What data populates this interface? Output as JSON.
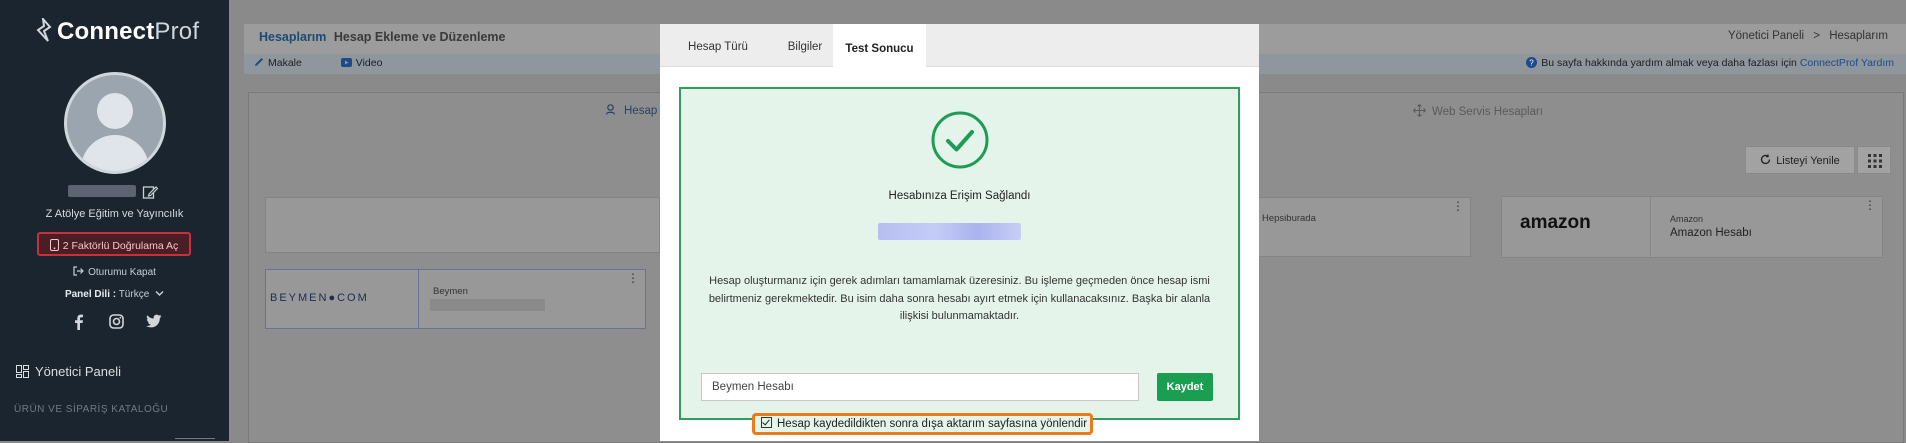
{
  "sidebar": {
    "logo_main": "Connect",
    "logo_accent": "Prof",
    "company": "Z Atölye Eğitim ve Yayıncılık",
    "twofa_label": "2 Faktörlü Doğrulama Aç",
    "logout_label": "Oturumu Kapat",
    "lang_label": "Panel Dili :",
    "lang_value": "Türkçe",
    "admin_menu": "Yönetici Paneli",
    "catalog_menu": "ÜRÜN VE SİPARİŞ KATALOĞU",
    "social_icons": [
      "facebook-icon",
      "instagram-icon",
      "twitter-icon"
    ]
  },
  "header": {
    "title": "Hesaplarım",
    "subtitle": "Hesap Ekleme ve Düzenleme",
    "breadcrumb_root": "Yönetici Paneli",
    "breadcrumb_sep": ">",
    "breadcrumb_current": "Hesaplarım"
  },
  "subbar": {
    "article": "Makale",
    "video": "Video",
    "help_text": "Bu sayfa hakkında yardım almak veya daha fazlası için",
    "help_link": "ConnectProf Yardım"
  },
  "main": {
    "tab_accounts": "Hesap",
    "tab_webservice": "Web Servis Hesapları",
    "refresh_label": "Listeyi Yenile",
    "cards": {
      "hepsiburada_label": "Hepsiburada",
      "amazon_logo": "amazon",
      "amazon_label": "Amazon",
      "amazon_name": "Amazon Hesabı",
      "beymen_logo": "BEYMEN●COM",
      "beymen_label": "Beymen"
    }
  },
  "modal": {
    "tabs": [
      "Hesap Türü",
      "Bilgiler",
      "Test Sonucu"
    ],
    "active_tab": "Test Sonucu",
    "success_title": "Hesabınıza Erişim Sağlandı",
    "description": "Hesap oluşturmanız için gerek adımları tamamlamak üzeresiniz. Bu işleme geçmeden önce hesap ismi belirtmeniz gerekmektedir. Bu isim daha sonra hesabı ayırt etmek için kullanacaksınız. Başka bir alanla ilişkisi bulunmamaktadır.",
    "name_value": "Beymen Hesabı",
    "save_label": "Kaydet",
    "redirect_label": "Hesap kaydedildikten sonra dışa aktarım sayfasına yönlendir",
    "redirect_checked": true
  },
  "colors": {
    "success_green": "#2aa05a",
    "save_green": "#1a9e4f",
    "highlight_orange": "#ea7a1c",
    "twofa_red": "#c9303e"
  }
}
